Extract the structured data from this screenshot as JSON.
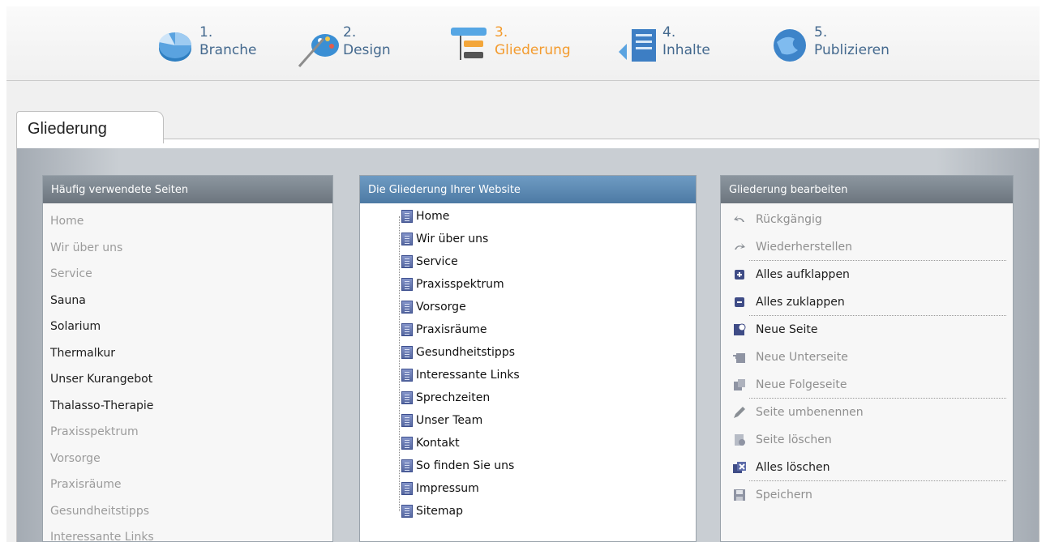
{
  "wizard": {
    "steps": [
      {
        "number": "1.",
        "label": "Branche",
        "icon": "pie-chart-icon",
        "active": false
      },
      {
        "number": "2.",
        "label": "Design",
        "icon": "palette-brush-icon",
        "active": false
      },
      {
        "number": "3.",
        "label": "Gliederung",
        "icon": "outline-tree-icon",
        "active": true
      },
      {
        "number": "4.",
        "label": "Inhalte",
        "icon": "content-document-icon",
        "active": false
      },
      {
        "number": "5.",
        "label": "Publizieren",
        "icon": "globe-publish-icon",
        "active": false
      }
    ],
    "active_color": "#f39b2e",
    "inactive_color": "#44698e"
  },
  "tab": {
    "label": "Gliederung"
  },
  "left_panel": {
    "title": "Häufig verwendete Seiten",
    "items": [
      {
        "label": "Home",
        "used": true
      },
      {
        "label": "Wir über uns",
        "used": true
      },
      {
        "label": "Service",
        "used": true
      },
      {
        "label": "Sauna",
        "used": false
      },
      {
        "label": "Solarium",
        "used": false
      },
      {
        "label": "Thermalkur",
        "used": false
      },
      {
        "label": "Unser Kurangebot",
        "used": false
      },
      {
        "label": "Thalasso-Therapie",
        "used": false
      },
      {
        "label": "Praxisspektrum",
        "used": true
      },
      {
        "label": "Vorsorge",
        "used": true
      },
      {
        "label": "Praxisräume",
        "used": true
      },
      {
        "label": "Gesundheitstipps",
        "used": true
      },
      {
        "label": "Interessante Links",
        "used": true
      }
    ]
  },
  "middle_panel": {
    "title": "Die Gliederung Ihrer Website",
    "pages": [
      "Home",
      "Wir über uns",
      "Service",
      "Praxisspektrum",
      "Vorsorge",
      "Praxisräume",
      "Gesundheitstipps",
      "Interessante Links",
      "Sprechzeiten",
      "Unser Team",
      "Kontakt",
      "So finden Sie uns",
      "Impressum",
      "Sitemap"
    ]
  },
  "right_panel": {
    "title": "Gliederung bearbeiten",
    "actions": [
      {
        "label": "Rückgängig",
        "icon": "undo-icon",
        "enabled": false,
        "separator": false
      },
      {
        "label": "Wiederherstellen",
        "icon": "redo-icon",
        "enabled": false,
        "separator": true
      },
      {
        "label": "Alles aufklappen",
        "icon": "expand-all-icon",
        "enabled": true,
        "separator": false
      },
      {
        "label": "Alles zuklappen",
        "icon": "collapse-all-icon",
        "enabled": true,
        "separator": true
      },
      {
        "label": "Neue Seite",
        "icon": "new-page-icon",
        "enabled": true,
        "separator": false
      },
      {
        "label": "Neue Unterseite",
        "icon": "new-subpage-icon",
        "enabled": false,
        "separator": false
      },
      {
        "label": "Neue Folgeseite",
        "icon": "new-following-page-icon",
        "enabled": false,
        "separator": true
      },
      {
        "label": "Seite umbenennen",
        "icon": "rename-pencil-icon",
        "enabled": false,
        "separator": false
      },
      {
        "label": "Seite löschen",
        "icon": "delete-page-icon",
        "enabled": false,
        "separator": false
      },
      {
        "label": "Alles löschen",
        "icon": "delete-all-icon",
        "enabled": true,
        "separator": true
      },
      {
        "label": "Speichern",
        "icon": "save-disk-icon",
        "enabled": false,
        "separator": false
      }
    ]
  }
}
